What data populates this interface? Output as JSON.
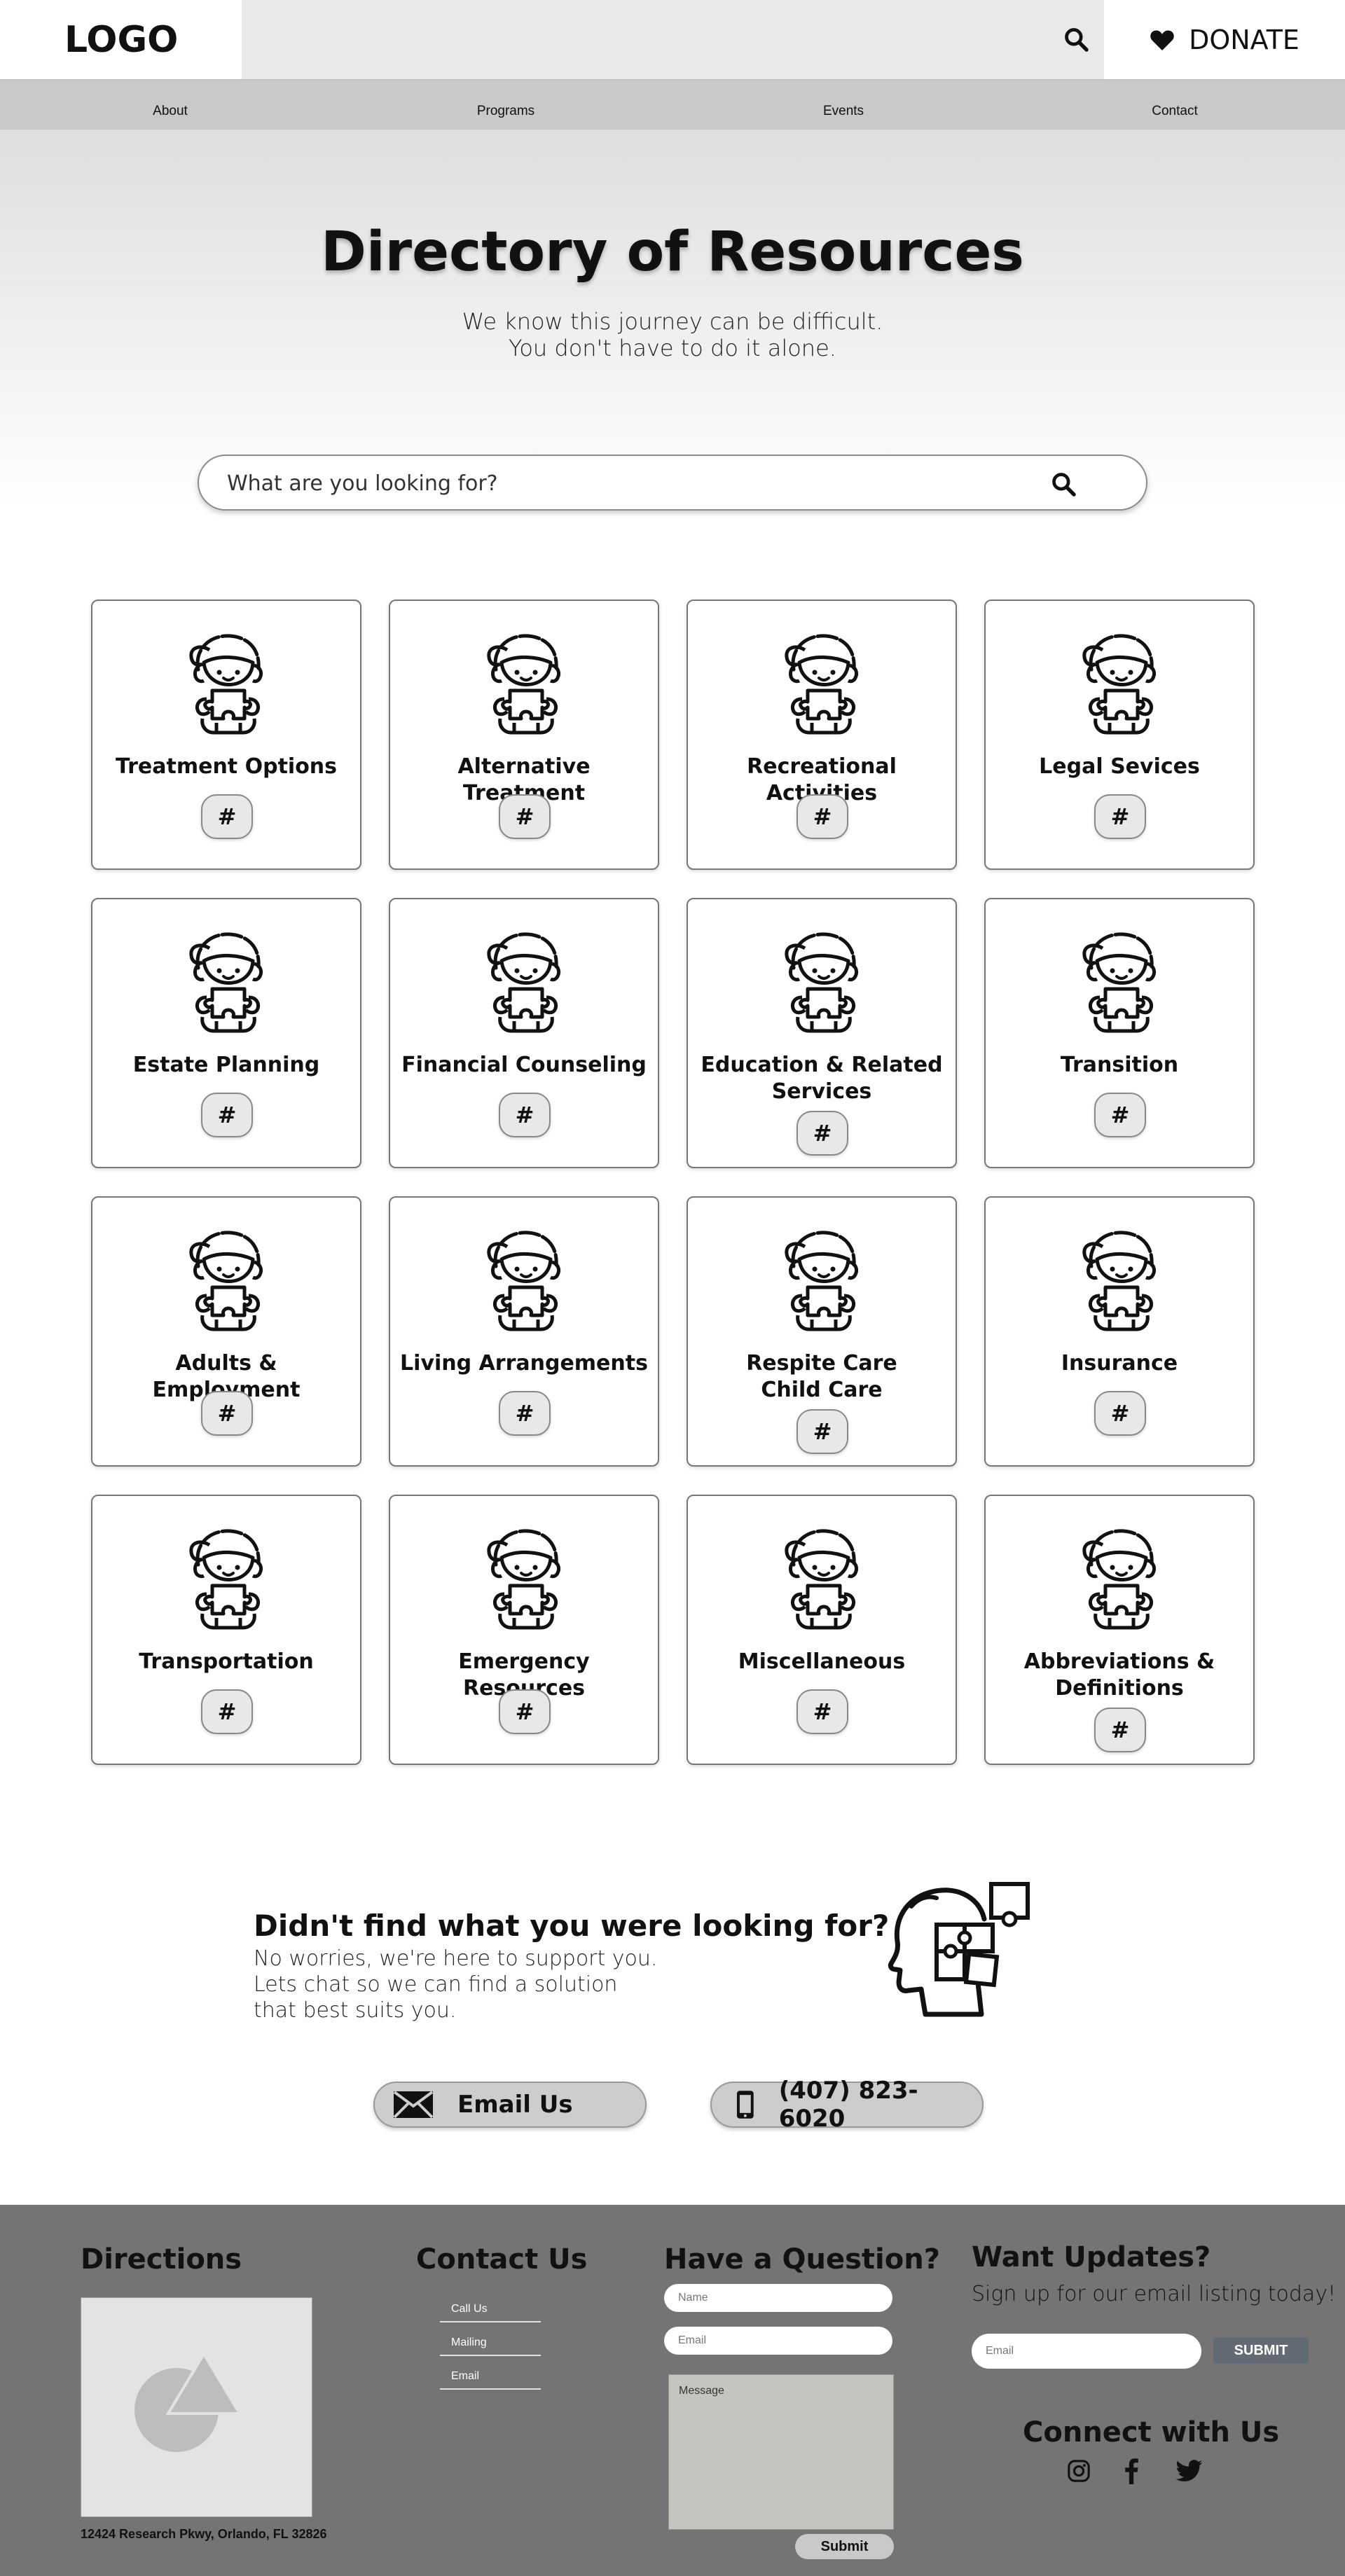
{
  "header": {
    "logo": "LOGO",
    "donate_label": "DONATE"
  },
  "nav": {
    "items": [
      "About",
      "Programs",
      "Events",
      "Contact"
    ]
  },
  "hero": {
    "title": "Directory of Resources",
    "subtitle_line1": "We know this journey can be difficult.",
    "subtitle_line2": "You don't have to do it alone."
  },
  "search": {
    "placeholder": "What are you looking for?"
  },
  "cards": [
    {
      "title_line1": "Treatment Options",
      "title_line2": "",
      "hash": "#"
    },
    {
      "title_line1": "Alternative Treatment",
      "title_line2": "",
      "hash": "#"
    },
    {
      "title_line1": "Recreational Activities",
      "title_line2": "",
      "hash": "#"
    },
    {
      "title_line1": "Legal Sevices",
      "title_line2": "",
      "hash": "#"
    },
    {
      "title_line1": "Estate Planning",
      "title_line2": "",
      "hash": "#"
    },
    {
      "title_line1": "Financial Counseling",
      "title_line2": "",
      "hash": "#"
    },
    {
      "title_line1": "Education & Related",
      "title_line2": "Services",
      "hash": "#"
    },
    {
      "title_line1": "Transition",
      "title_line2": "",
      "hash": "#"
    },
    {
      "title_line1": "Adults & Employment",
      "title_line2": "",
      "hash": "#"
    },
    {
      "title_line1": "Living Arrangements",
      "title_line2": "",
      "hash": "#"
    },
    {
      "title_line1": "Respite Care",
      "title_line2": "Child Care",
      "hash": "#"
    },
    {
      "title_line1": "Insurance",
      "title_line2": "",
      "hash": "#"
    },
    {
      "title_line1": "Transportation",
      "title_line2": "",
      "hash": "#"
    },
    {
      "title_line1": "Emergency Resources",
      "title_line2": "",
      "hash": "#"
    },
    {
      "title_line1": "Miscellaneous",
      "title_line2": "",
      "hash": "#"
    },
    {
      "title_line1": "Abbreviations &",
      "title_line2": "Definitions",
      "hash": "#"
    }
  ],
  "not_found": {
    "title": "Didn't find what you were looking for?",
    "line1": "No worries, we're here to support you.",
    "line2": "Lets chat so we can find a solution",
    "line3": "that best suits you.",
    "email_label": "Email Us",
    "phone_label": "(407) 823-6020"
  },
  "footer": {
    "directions_title": "Directions",
    "address": "12424 Research Pkwy, Orlando, FL 32826",
    "contact_title": "Contact Us",
    "contact_links": [
      "Call Us",
      "Mailing",
      "Email"
    ],
    "question_title": "Have a Question?",
    "name_placeholder": "Name",
    "email_placeholder": "Email",
    "message_placeholder": "Message",
    "submit_label": "Submit",
    "updates_title": "Want Updates?",
    "updates_sub": "Sign up for our email listing today!",
    "updates_email_placeholder": "Email",
    "updates_submit": "SUBMIT",
    "connect_title": "Connect with Us",
    "social": [
      "instagram-icon",
      "facebook-icon",
      "twitter-icon"
    ]
  }
}
